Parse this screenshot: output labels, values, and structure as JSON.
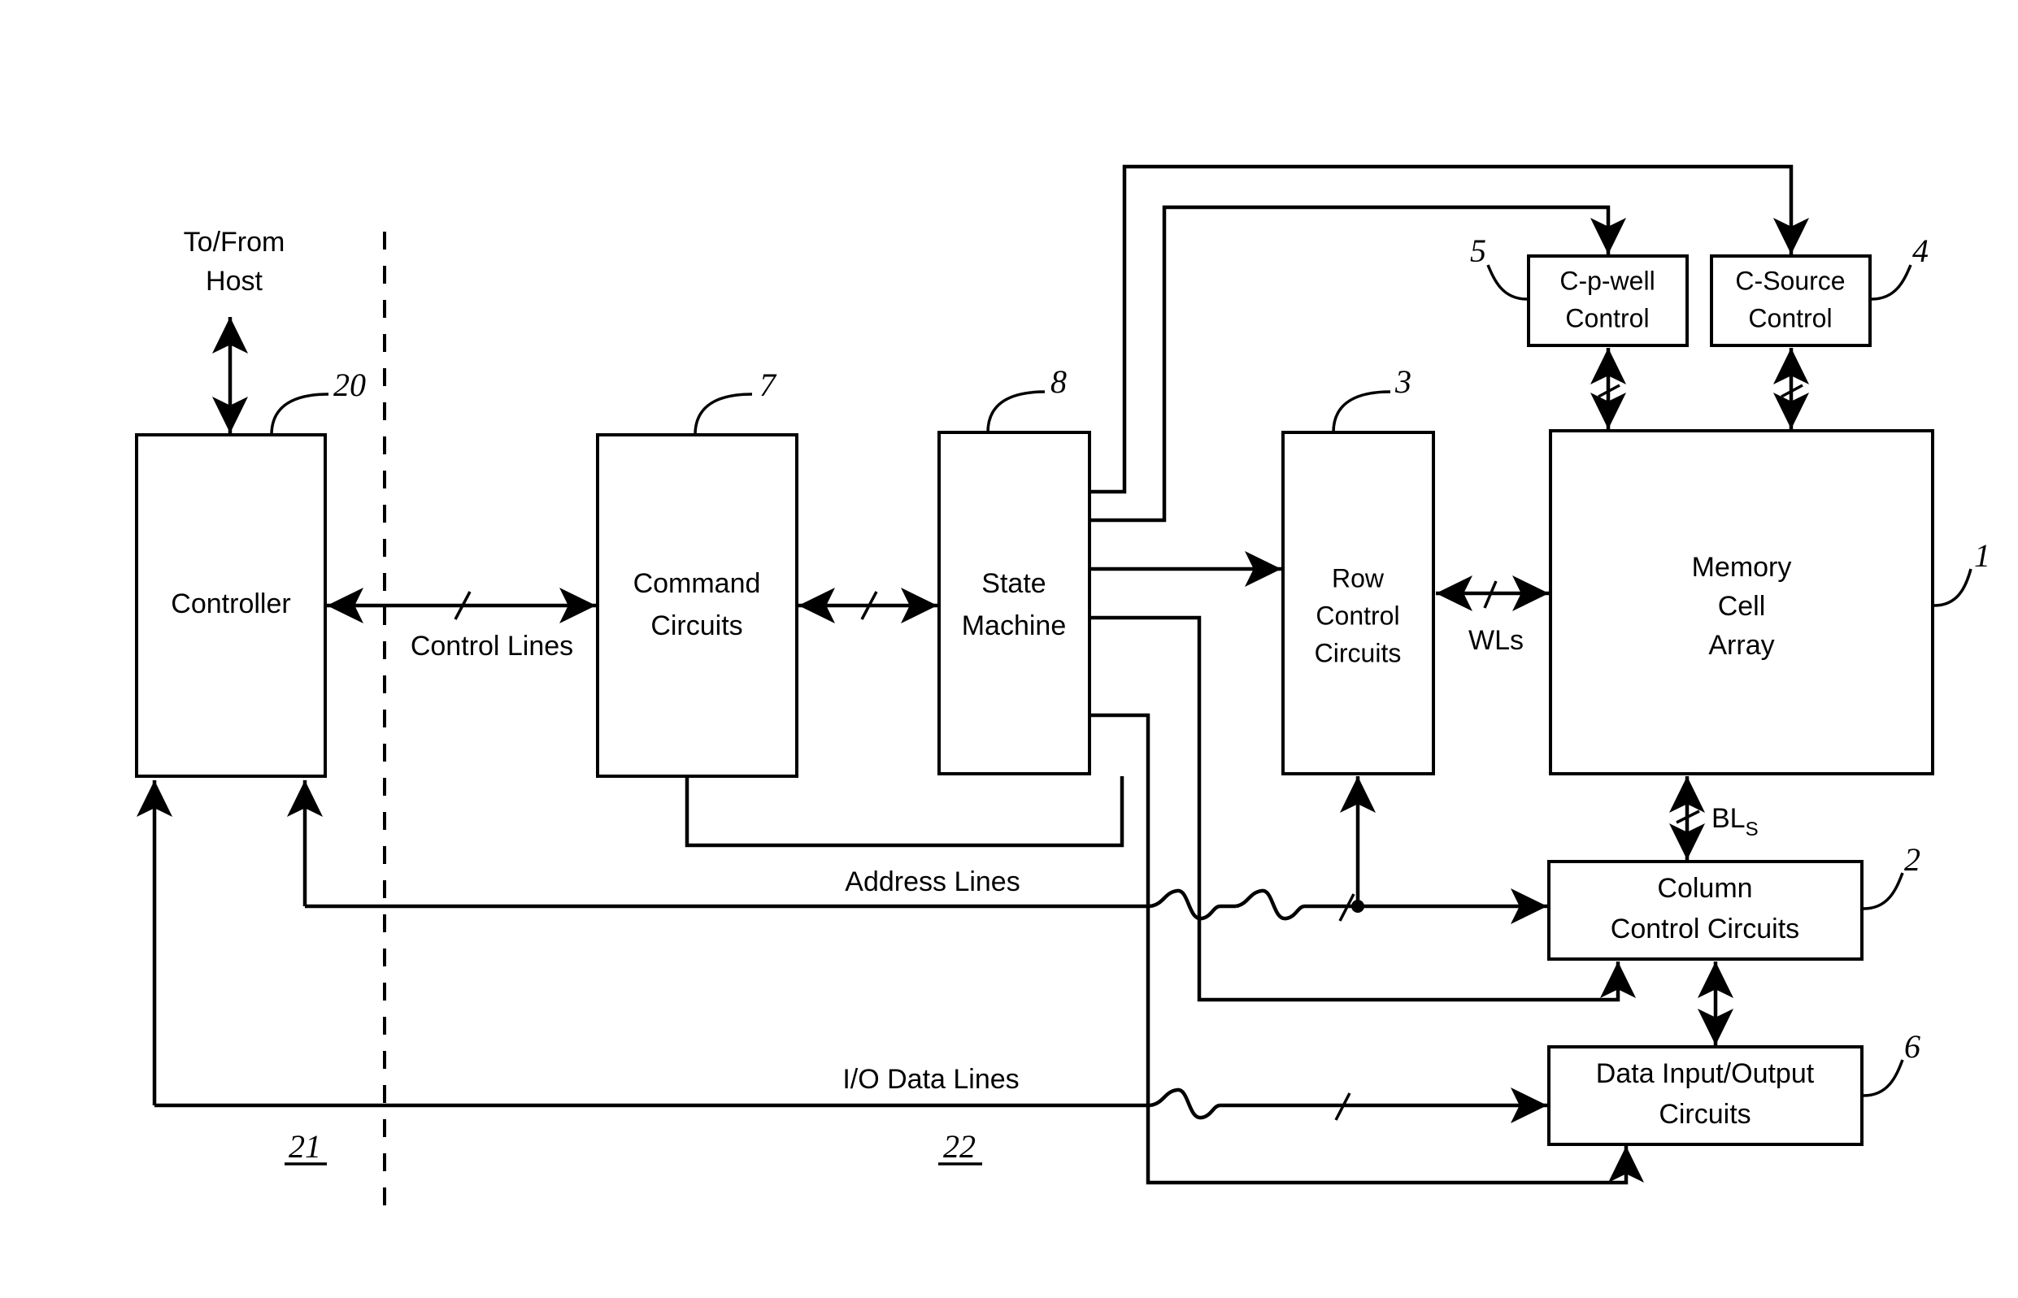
{
  "figure": {
    "kind": "patent-block-diagram",
    "ink_color": "#000000",
    "background_color": "#ffffff"
  },
  "blocks": [
    {
      "id": "controller",
      "lines": [
        "Controller"
      ],
      "ref": "20"
    },
    {
      "id": "command",
      "lines": [
        "Command",
        "Circuits"
      ],
      "ref": "7"
    },
    {
      "id": "state",
      "lines": [
        "State",
        "Machine"
      ],
      "ref": "8"
    },
    {
      "id": "row",
      "lines": [
        "Row",
        "Control",
        "Circuits"
      ],
      "ref": "3"
    },
    {
      "id": "array",
      "lines": [
        "Memory",
        "Cell",
        "Array"
      ],
      "ref": "1"
    },
    {
      "id": "cpwell",
      "lines": [
        "C-p-well",
        "Control"
      ],
      "ref": "5"
    },
    {
      "id": "csource",
      "lines": [
        "C-Source",
        "Control"
      ],
      "ref": "4"
    },
    {
      "id": "column",
      "lines": [
        "Column",
        "Control Circuits"
      ],
      "ref": "2"
    },
    {
      "id": "dataio",
      "lines": [
        "Data Input/Output",
        "Circuits"
      ],
      "ref": "6"
    }
  ],
  "labels": {
    "to_from_host_line1": "To/From",
    "to_from_host_line2": "Host",
    "control_lines": "Control Lines",
    "address_lines": "Address Lines",
    "io_data_lines": "I/O Data Lines",
    "wls": "WLs",
    "bls_main": "BL",
    "bls_sub": "S",
    "bus_ref_21": "21",
    "bus_ref_22": "22"
  },
  "refs": {
    "controller": "20",
    "command_circuits": "7",
    "state_machine": "8",
    "row_control": "3",
    "memory_cell_array": "1",
    "cpwell_control": "5",
    "csource_control": "4",
    "column_control": "2",
    "data_io": "6"
  }
}
